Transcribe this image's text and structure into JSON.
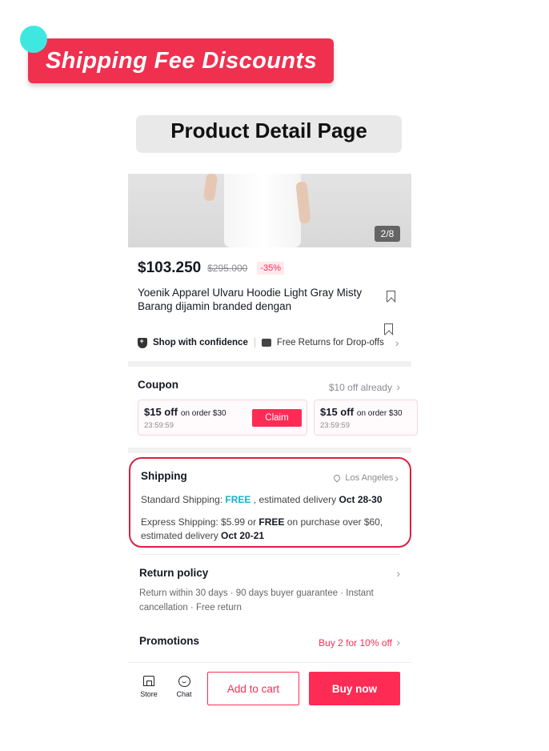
{
  "banner": {
    "title": "Shipping Fee Discounts"
  },
  "page_label": "Product Detail Page",
  "product": {
    "image_counter": "2/8",
    "price": "$103.250",
    "original_price": "$295.000",
    "discount": "-35%",
    "title": "Yoenik Apparel Ulvaru Hoodie Light Gray Misty Barang dijamin branded dengan"
  },
  "trust": {
    "shop_confidence": "Shop with confidence",
    "free_returns": "Free Returns for Drop-offs"
  },
  "coupon": {
    "title": "Coupon",
    "link": "$10 off already",
    "cards": [
      {
        "amount": "$15 off",
        "condition": "on order $30",
        "timer": "23:59:59",
        "button": "Claim"
      },
      {
        "amount": "$15 off",
        "condition": "on order $30",
        "timer": "23:59:59"
      }
    ]
  },
  "shipping": {
    "title": "Shipping",
    "location": "Los Angeles",
    "standard_prefix": "Standard Shipping: ",
    "standard_free": "FREE",
    "standard_mid": " , estimated delivery ",
    "standard_date": "Oct 28-30",
    "express_prefix": "Express Shipping: $5.99 or ",
    "express_free": "FREE",
    "express_mid": " on purchase over $60, estimated delivery ",
    "express_date": "Oct 20-21"
  },
  "return_policy": {
    "title": "Return policy",
    "text": "Return within 30 days · 90 days buyer guarantee · Instant cancellation · Free return"
  },
  "promotions": {
    "title": "Promotions",
    "link": "Buy 2 for 10% off"
  },
  "bottom_bar": {
    "store": "Store",
    "chat": "Chat",
    "add_to_cart": "Add to cart",
    "buy_now": "Buy now"
  },
  "colors": {
    "accent": "#fe2c55",
    "banner": "#f0304f",
    "banner_dot": "#3ee8e1",
    "free_text": "#17b1c7",
    "highlight_border": "#d8203f"
  }
}
